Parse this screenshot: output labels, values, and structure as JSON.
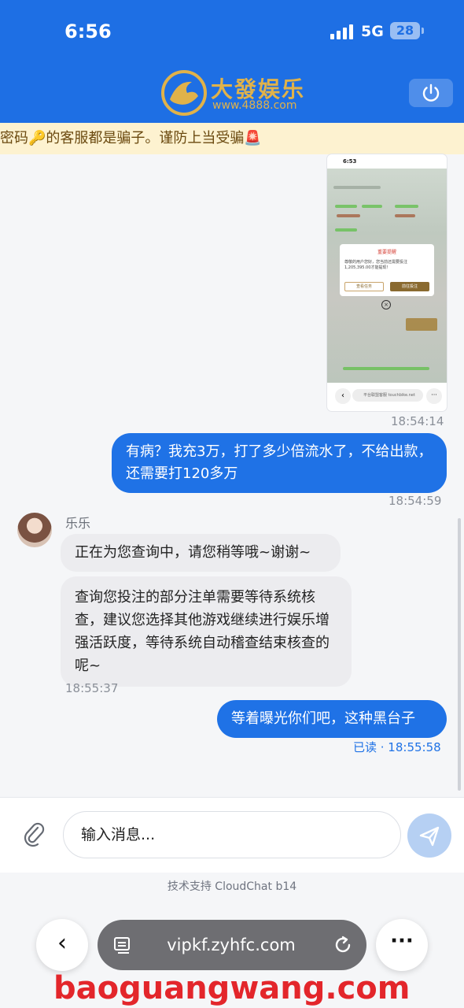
{
  "status_bar": {
    "time": "6:56",
    "network": "5G",
    "battery": "28"
  },
  "brand": {
    "name": "大發娱乐",
    "url": "www.4888.com"
  },
  "notice": {
    "text": "密码🔑的客服都是骗子。谨防上当受骗🚨"
  },
  "shared_screenshot": {
    "time": "6:53",
    "modal_title": "重要提醒",
    "modal_text": "尊敬的用户您好，您当前还需要投注1,205,395.00才能提现！",
    "modal_btn_left": "查看任务",
    "modal_btn_right": "前往投注",
    "url": "平台联盟客服 touchbike.net",
    "timestamp": "18:54:14"
  },
  "messages": [
    {
      "direction": "out",
      "text": "有病？我充3万，打了多少倍流水了，不给出款，还需要打120多万",
      "time": "18:54:59"
    },
    {
      "direction": "in",
      "sender": "乐乐",
      "text": "正在为您查询中，请您稍等哦~谢谢~"
    },
    {
      "direction": "in",
      "text": "查询您投注的部分注单需要等待系统核查，建议您选择其他游戏继续进行娱乐增强活跃度，等待系统自动稽查结束核查的呢~",
      "time": "18:55:37"
    },
    {
      "direction": "out",
      "text": "等着曝光你们吧，这种黑台子",
      "time": "已读 · 18:55:58"
    }
  ],
  "composer": {
    "placeholder": "输入消息..."
  },
  "footer": {
    "powered_by": "技术支持 CloudChat b14"
  },
  "browser": {
    "url": "vipkf.zyhfc.com"
  },
  "watermark": {
    "text": "baoguangwang.com",
    "color": "#e3262b"
  },
  "colors": {
    "header_blue": "#1e6fe4",
    "bubble_blue": "#1f72e6",
    "gold": "#e0b24a"
  }
}
